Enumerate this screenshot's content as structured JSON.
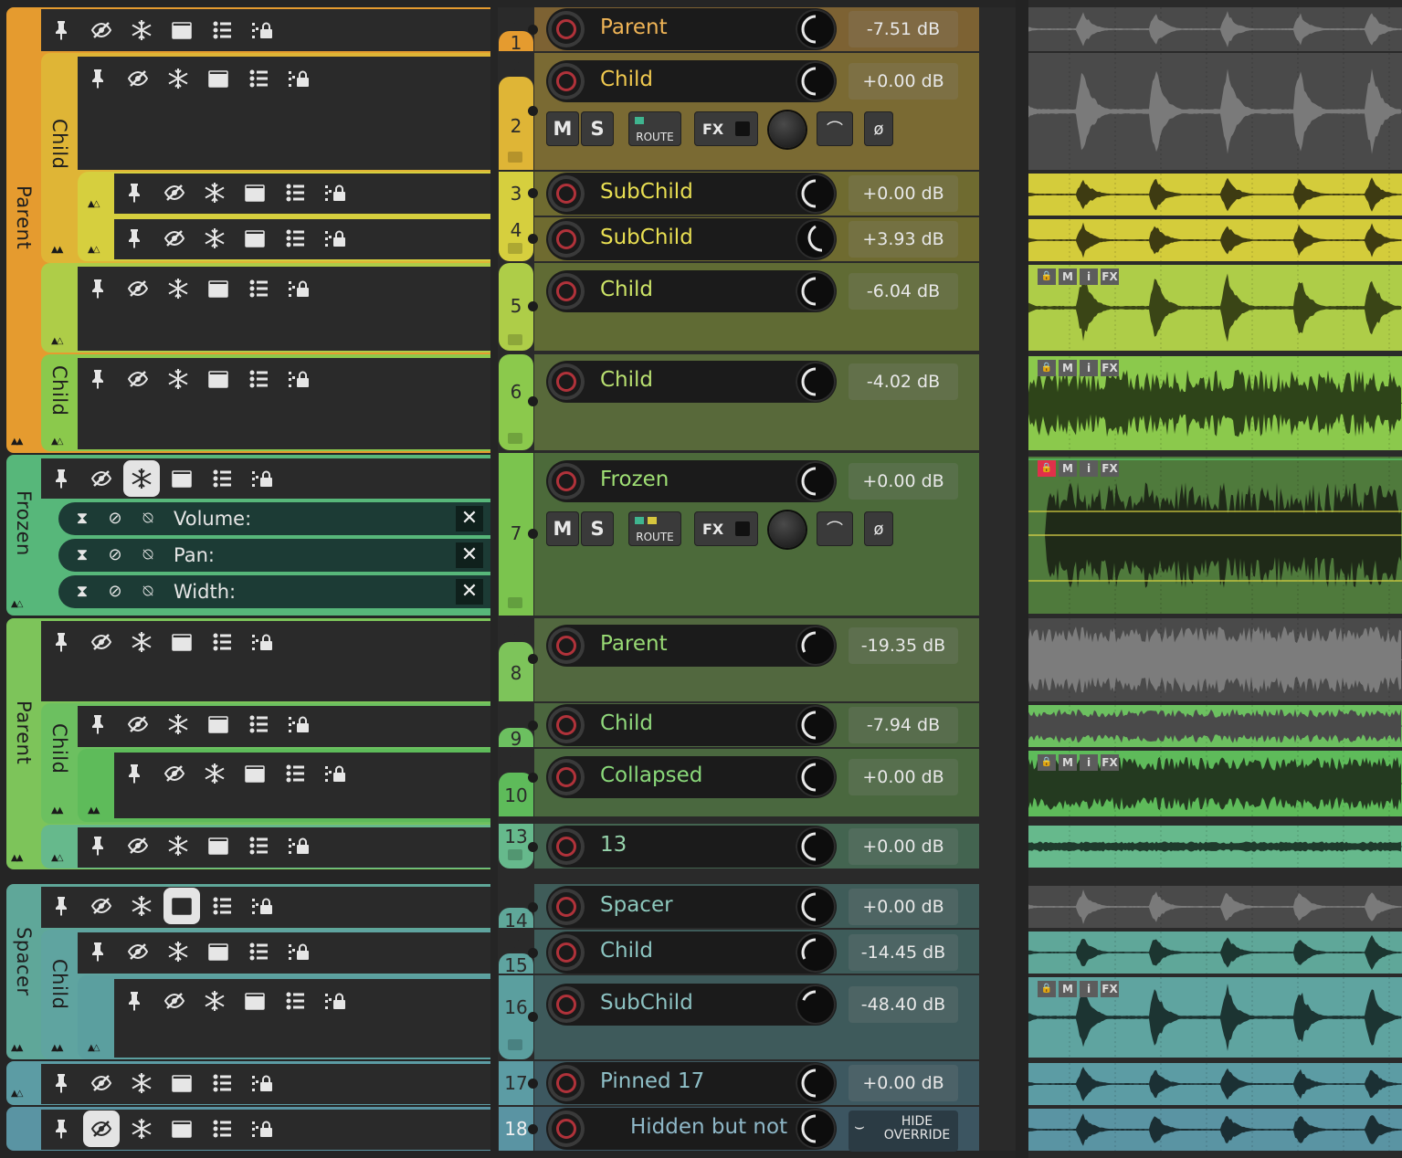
{
  "left": {
    "folder_labels": {
      "parent1": "Parent",
      "child2": "Child",
      "child6": "Child",
      "frozen": "Frozen",
      "parent8": "Parent",
      "child9": "Child",
      "spacer": "Spacer",
      "child15": "Child"
    },
    "icon_names": [
      "pin-icon",
      "hide-icon",
      "freeze-icon",
      "window-icon",
      "list-icon",
      "lock-icon"
    ],
    "envelopes": [
      {
        "name": "Volume:"
      },
      {
        "name": "Pan:"
      },
      {
        "name": "Width:"
      }
    ]
  },
  "tracks": [
    {
      "num": "1",
      "name": "Parent",
      "volume": "-7.51 dB"
    },
    {
      "num": "2",
      "name": "Child",
      "volume": "+0.00 dB"
    },
    {
      "num": "3",
      "name": "SubChild",
      "volume": "+0.00 dB"
    },
    {
      "num": "4",
      "name": "SubChild",
      "volume": "+3.93 dB"
    },
    {
      "num": "5",
      "name": "Child",
      "volume": "-6.04 dB"
    },
    {
      "num": "6",
      "name": "Child",
      "volume": "-4.02 dB"
    },
    {
      "num": "7",
      "name": "Frozen",
      "volume": "+0.00 dB"
    },
    {
      "num": "8",
      "name": "Parent",
      "volume": "-19.35 dB"
    },
    {
      "num": "9",
      "name": "Child",
      "volume": "-7.94 dB"
    },
    {
      "num": "10",
      "name": "Collapsed",
      "volume": "+0.00 dB"
    },
    {
      "num": "13",
      "name": "13",
      "volume": "+0.00 dB"
    },
    {
      "num": "14",
      "name": "Spacer",
      "volume": "+0.00 dB"
    },
    {
      "num": "15",
      "name": "Child",
      "volume": "-14.45 dB"
    },
    {
      "num": "16",
      "name": "SubChild",
      "volume": "-48.40 dB"
    },
    {
      "num": "17",
      "name": "Pinned 17",
      "volume": "+0.00 dB"
    },
    {
      "num": "18",
      "name": "Hidden but not",
      "volume": ""
    }
  ],
  "controls": {
    "mute": "M",
    "solo": "S",
    "route": "ROUTE",
    "fx": "FX",
    "hide_override_line1": "HIDE",
    "hide_override_line2": "OVERRIDE"
  },
  "item_tags": [
    "M",
    "i",
    "FX"
  ],
  "colors": {
    "orange": "#e59b2f",
    "gold": "#dfb536",
    "yellow": "#d6cf3e",
    "lime": "#aecd48",
    "green": "#8bc94c",
    "mint": "#57b77a",
    "teal": "#5fa799",
    "slate": "#5e98a3",
    "rec": "#b0323a",
    "bg": "#252525"
  }
}
